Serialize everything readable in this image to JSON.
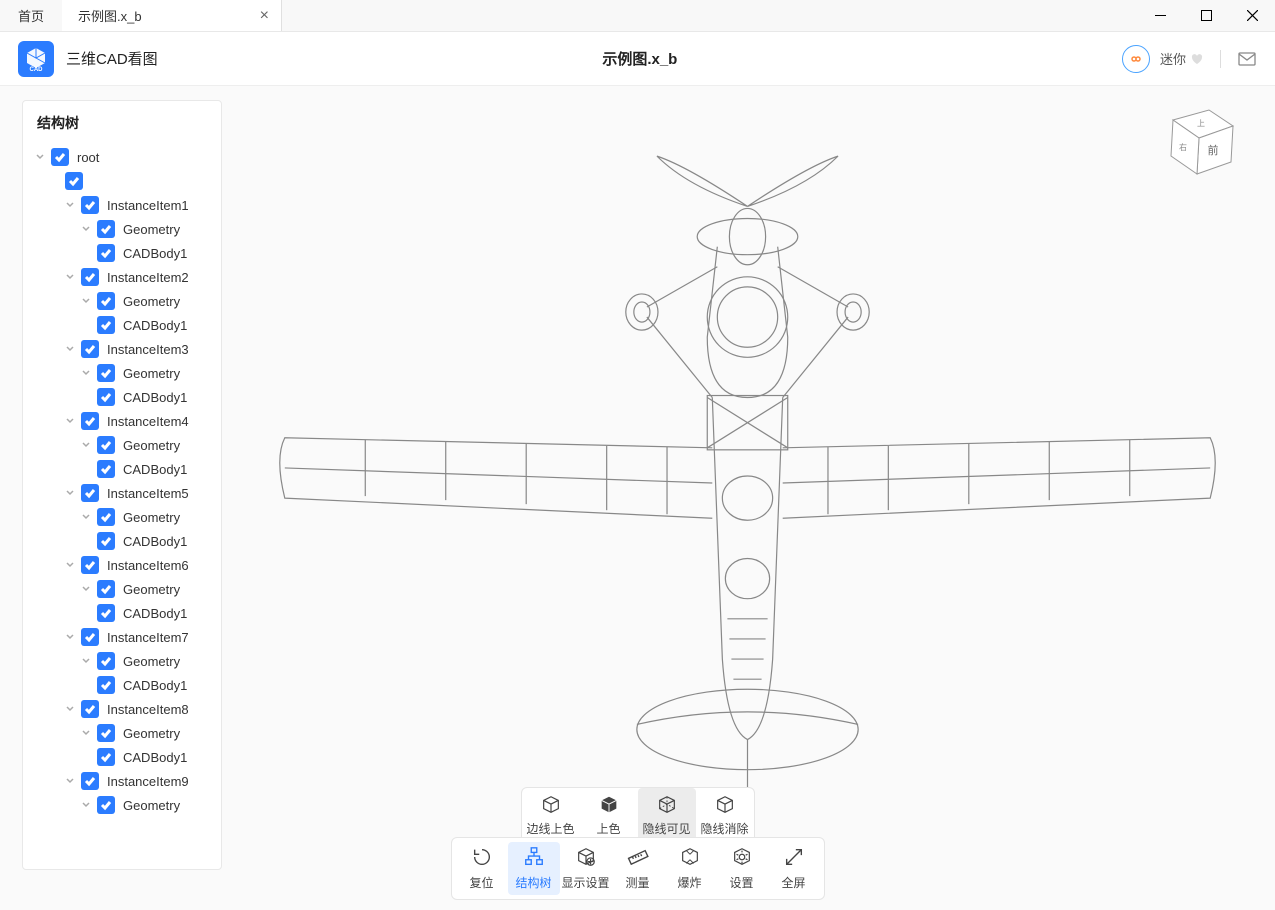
{
  "titlebar": {
    "home_tab": "首页",
    "file_tab": "示例图.x_b"
  },
  "header": {
    "app_name": "三维CAD看图",
    "document_title": "示例图.x_b",
    "user_name": "迷你"
  },
  "tree": {
    "title": "结构树",
    "nodes": [
      {
        "depth": 0,
        "label": "root",
        "toggle": true
      },
      {
        "depth": 1,
        "label": "",
        "toggle": false
      },
      {
        "depth": 2,
        "label": "InstanceItem1",
        "toggle": true
      },
      {
        "depth": 3,
        "label": "Geometry",
        "toggle": true
      },
      {
        "depth": 3,
        "label": "CADBody1",
        "toggle": false
      },
      {
        "depth": 2,
        "label": "InstanceItem2",
        "toggle": true
      },
      {
        "depth": 3,
        "label": "Geometry",
        "toggle": true
      },
      {
        "depth": 3,
        "label": "CADBody1",
        "toggle": false
      },
      {
        "depth": 2,
        "label": "InstanceItem3",
        "toggle": true
      },
      {
        "depth": 3,
        "label": "Geometry",
        "toggle": true
      },
      {
        "depth": 3,
        "label": "CADBody1",
        "toggle": false
      },
      {
        "depth": 2,
        "label": "InstanceItem4",
        "toggle": true
      },
      {
        "depth": 3,
        "label": "Geometry",
        "toggle": true
      },
      {
        "depth": 3,
        "label": "CADBody1",
        "toggle": false
      },
      {
        "depth": 2,
        "label": "InstanceItem5",
        "toggle": true
      },
      {
        "depth": 3,
        "label": "Geometry",
        "toggle": true
      },
      {
        "depth": 3,
        "label": "CADBody1",
        "toggle": false
      },
      {
        "depth": 2,
        "label": "InstanceItem6",
        "toggle": true
      },
      {
        "depth": 3,
        "label": "Geometry",
        "toggle": true
      },
      {
        "depth": 3,
        "label": "CADBody1",
        "toggle": false
      },
      {
        "depth": 2,
        "label": "InstanceItem7",
        "toggle": true
      },
      {
        "depth": 3,
        "label": "Geometry",
        "toggle": true
      },
      {
        "depth": 3,
        "label": "CADBody1",
        "toggle": false
      },
      {
        "depth": 2,
        "label": "InstanceItem8",
        "toggle": true
      },
      {
        "depth": 3,
        "label": "Geometry",
        "toggle": true
      },
      {
        "depth": 3,
        "label": "CADBody1",
        "toggle": false
      },
      {
        "depth": 2,
        "label": "InstanceItem9",
        "toggle": true
      },
      {
        "depth": 3,
        "label": "Geometry",
        "toggle": true
      }
    ]
  },
  "view_cube": {
    "top": "上",
    "front": "前",
    "left": "右"
  },
  "display_modes": [
    {
      "id": "edge-shaded",
      "label": "边线上色",
      "active": false
    },
    {
      "id": "shaded",
      "label": "上色",
      "active": false
    },
    {
      "id": "hidden-visible",
      "label": "隐线可见",
      "active": true
    },
    {
      "id": "hidden-removed",
      "label": "隐线消除",
      "active": false
    }
  ],
  "toolbar": [
    {
      "id": "reset",
      "label": "复位",
      "icon": "reset-icon",
      "active": false
    },
    {
      "id": "tree",
      "label": "结构树",
      "icon": "tree-icon",
      "active": true
    },
    {
      "id": "display",
      "label": "显示设置",
      "icon": "display-icon",
      "active": false
    },
    {
      "id": "measure",
      "label": "测量",
      "icon": "ruler-icon",
      "active": false
    },
    {
      "id": "explode",
      "label": "爆炸",
      "icon": "explode-icon",
      "active": false
    },
    {
      "id": "settings",
      "label": "设置",
      "icon": "gear-icon",
      "active": false
    },
    {
      "id": "fullscreen",
      "label": "全屏",
      "icon": "fullscreen-icon",
      "active": false
    }
  ]
}
